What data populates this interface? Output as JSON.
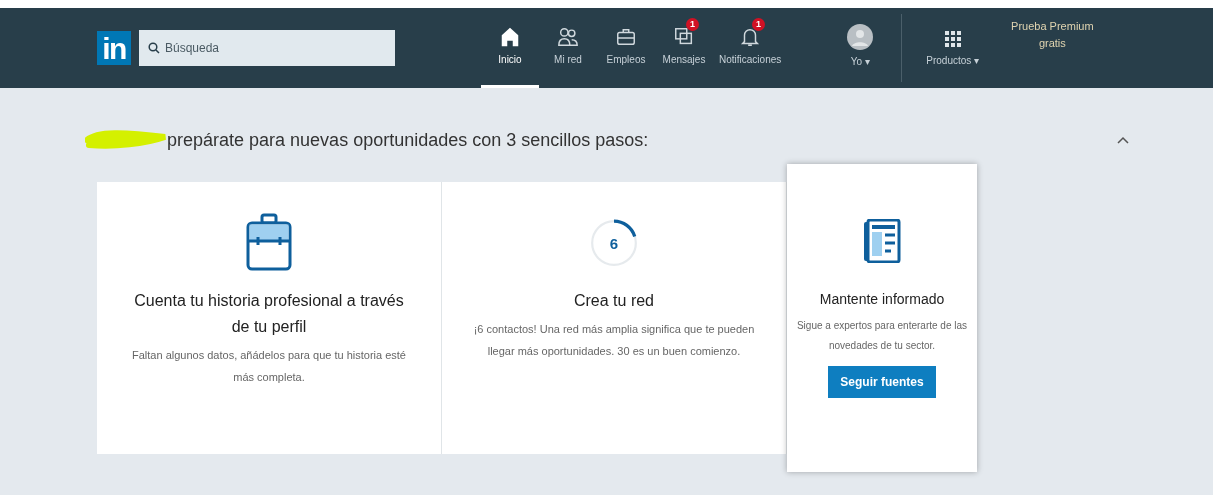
{
  "nav": {
    "logo": "in",
    "search": {
      "placeholder": "Búsqueda"
    },
    "items": [
      {
        "kind": "home",
        "label": "Inicio",
        "selected": true
      },
      {
        "kind": "people",
        "label": "Mi red",
        "selected": false
      },
      {
        "kind": "briefcase",
        "label": "Empleos",
        "selected": false
      },
      {
        "kind": "chat",
        "label": "Mensajes",
        "selected": false,
        "badge": "1"
      },
      {
        "kind": "bell",
        "label": "Notificaciones",
        "selected": false,
        "badge": "1"
      },
      {
        "kind": "avatar",
        "label": "Yo",
        "selected": false,
        "caret": "▾"
      }
    ],
    "products": {
      "label": "Productos",
      "caret": "▾"
    },
    "premium": [
      "Prueba Premium",
      "gratis"
    ]
  },
  "greeting": {
    "text": "prepárate para nuevas oportunidades con 3 sencillos pasos:",
    "name_redacted": true,
    "expanded": true
  },
  "steps": [
    {
      "kind": "briefcase",
      "title": "Cuenta tu historia profesional a través de tu perfil",
      "text": "Faltan algunos datos, añádelos para que tu historia esté más completa.",
      "highlighted": false
    },
    {
      "kind": "progress",
      "count": "6",
      "title": "Crea tu red",
      "text": "¡6 contactos! Una red más amplia significa que te pueden llegar más oportunidades. 30 es un buen comienzo.",
      "highlighted": false
    },
    {
      "kind": "newspaper",
      "title": "Mantente informado",
      "text": "Sigue a expertos para enterarte de las novedades de tu sector.",
      "button": "Seguir fuentes",
      "highlighted": true
    }
  ]
}
